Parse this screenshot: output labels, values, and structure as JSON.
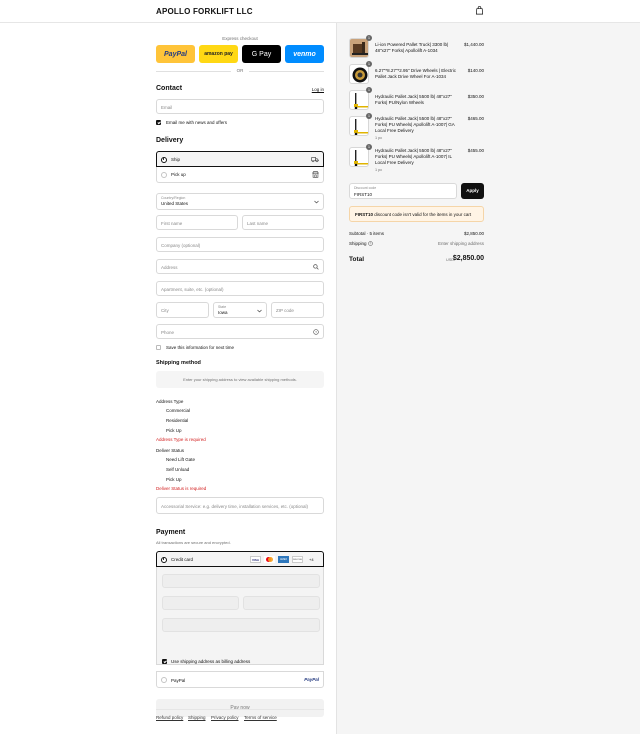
{
  "store": {
    "name": "APOLLO FORKLIFT LLC"
  },
  "express": {
    "title": "Express checkout",
    "buttons": [
      {
        "label": "PayPal",
        "color": "#ffc439",
        "text_color": "#253b80"
      },
      {
        "label": "amazon pay",
        "color": "#ffd814",
        "text_color": "#222222"
      },
      {
        "label": "G Pay",
        "color": "#000000",
        "text_color": "#ffffff"
      },
      {
        "label": "venmo",
        "color": "#008cff",
        "text_color": "#ffffff"
      }
    ],
    "or": "OR"
  },
  "contact": {
    "heading": "Contact",
    "login": "Log in",
    "email_placeholder": "Email",
    "newsletter": "Email me with news and offers"
  },
  "delivery": {
    "heading": "Delivery",
    "options": [
      {
        "label": "Ship",
        "icon": "truck-icon",
        "selected": true
      },
      {
        "label": "Pick up",
        "icon": "store-icon",
        "selected": false
      }
    ],
    "country_label": "Country/Region",
    "country_value": "United States",
    "first_name": "First name",
    "last_name": "Last name",
    "company": "Company (optional)",
    "address": "Address",
    "apartment": "Apartment, suite, etc. (optional)",
    "city": "City",
    "state_label": "State",
    "state_value": "Iowa",
    "zip": "ZIP code",
    "phone": "Phone",
    "save_info": "Save this information for next time"
  },
  "shipping_method": {
    "heading": "Shipping method",
    "notice": "Enter your shipping address to view available shipping methods."
  },
  "address_type": {
    "heading": "Address Type",
    "options": [
      "Commercial",
      "Residential",
      "Pick Up"
    ],
    "error": "Address Type is required"
  },
  "deliver_status": {
    "heading": "Deliver Status",
    "options": [
      "Need Lift Gate",
      "Self Unload",
      "Pick Up"
    ],
    "error": "Deliver Status is required"
  },
  "accessorial": {
    "placeholder": "Accessorial Service: e.g. delivery time, installation services, etc. (optional)"
  },
  "payment": {
    "heading": "Payment",
    "subtitle": "All transactions are secure and encrypted.",
    "credit_card": "Credit card",
    "cards": [
      "VISA",
      "MC",
      "AMEX",
      "DISCOVER",
      "+4"
    ],
    "billing_same": "Use shipping address as billing address",
    "paypal": "PayPal",
    "pay_now": "Pay now"
  },
  "footer": {
    "links": [
      "Refund policy",
      "Shipping",
      "Privacy policy",
      "Terms of service"
    ]
  },
  "summary": {
    "items": [
      {
        "qty": "1",
        "name": "Li-ion Powered Pallet Truck| 3300 lb| 48\"x27\" Forks| Apollolift A-1034",
        "price": "$1,440.00",
        "sub": ""
      },
      {
        "qty": "1",
        "name": "6.27\"*8.27\"*2.95\" Drive Wheels | Electric Pallet Jack Drive Wheel For A-1034",
        "price": "$140.00",
        "sub": ""
      },
      {
        "qty": "1",
        "name": "Hydraulic Pallet Jack| 5500 lb| 48\"x27\" Forks| PU/Nylon Wheels",
        "price": "$350.00",
        "sub": ""
      },
      {
        "qty": "1",
        "name": "Hydraulic Pallet Jack| 5500 lb| 48\"x27\" Forks| PU Wheels| Apollolift A-1007| GA Local Free Delivery",
        "price": "$465.00",
        "sub": "1 pc"
      },
      {
        "qty": "1",
        "name": "Hydraulic Pallet Jack| 5500 lb| 48\"x27\" Forks| PU Wheels| Apollolift A-1007| IL Local Free Delivery",
        "price": "$455.00",
        "sub": "1 pc"
      }
    ],
    "discount_label": "Discount code",
    "discount_value": "FIRST10",
    "apply": "Apply",
    "discount_code_bold": "FIRST10",
    "discount_error": " discount code isn't valid for the items in your cart",
    "subtotal_label": "Subtotal · 5 items",
    "subtotal_value": "$2,850.00",
    "shipping_label": "Shipping",
    "shipping_value": "Enter shipping address",
    "total_label": "Total",
    "currency": "USD",
    "total_value": "$2,850.00"
  }
}
